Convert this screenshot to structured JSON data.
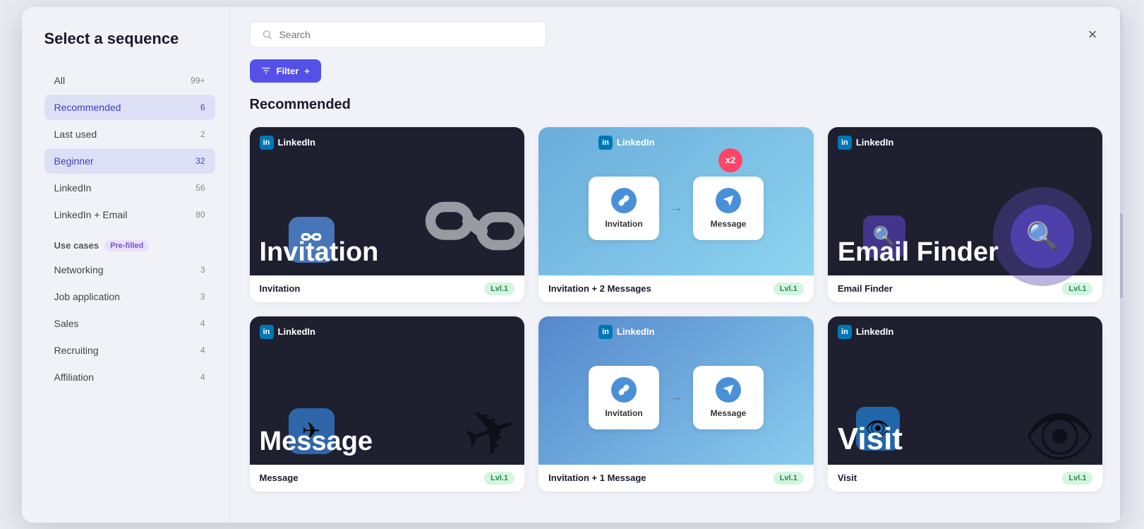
{
  "modal": {
    "title": "Select a sequence",
    "close_label": "×"
  },
  "sidebar": {
    "items": [
      {
        "label": "All",
        "count": "99+",
        "active": false
      },
      {
        "label": "Recommended",
        "count": "6",
        "active": true
      },
      {
        "label": "Last used",
        "count": "2",
        "active": false
      },
      {
        "label": "Beginner",
        "count": "32",
        "active": true,
        "secondary": true
      }
    ],
    "second_group": [
      {
        "label": "LinkedIn",
        "count": "56",
        "active": false
      },
      {
        "label": "LinkedIn + Email",
        "count": "80",
        "active": false
      }
    ],
    "use_cases_label": "Use cases",
    "pre_filled_label": "Pre-filled",
    "use_case_items": [
      {
        "label": "Networking",
        "count": "3"
      },
      {
        "label": "Job application",
        "count": "3"
      },
      {
        "label": "Sales",
        "count": "4"
      },
      {
        "label": "Recruiting",
        "count": "4"
      },
      {
        "label": "Affiliation",
        "count": "4"
      }
    ]
  },
  "search": {
    "placeholder": "Search"
  },
  "filter_btn": "Filter",
  "section": {
    "heading": "Recommended"
  },
  "cards": [
    {
      "id": "invitation",
      "title": "Invitation",
      "level": "Lvl.1",
      "type": "single",
      "linkedin": "LinkedIn",
      "card_label": "Invitation"
    },
    {
      "id": "invitation-2-messages",
      "title": "Invitation + 2 Messages",
      "level": "Lvl.1",
      "type": "flow",
      "linkedin": "LinkedIn",
      "step1": "Invitation",
      "step2": "Message",
      "x2": "x2"
    },
    {
      "id": "email-finder",
      "title": "Email Finder",
      "level": "Lvl.1",
      "type": "single",
      "linkedin": "LinkedIn",
      "card_label": "Email Finder"
    },
    {
      "id": "message",
      "title": "Message",
      "level": "Lvl.1",
      "type": "single",
      "linkedin": "LinkedIn",
      "card_label": "Message"
    },
    {
      "id": "invitation-1-message",
      "title": "Invitation + 1 Message",
      "level": "Lvl.1",
      "type": "flow",
      "linkedin": "LinkedIn",
      "step1": "Invitation",
      "step2": "Message"
    },
    {
      "id": "visit",
      "title": "Visit",
      "level": "Lvl.1",
      "type": "single",
      "linkedin": "LinkedIn",
      "card_label": "Visit"
    }
  ]
}
